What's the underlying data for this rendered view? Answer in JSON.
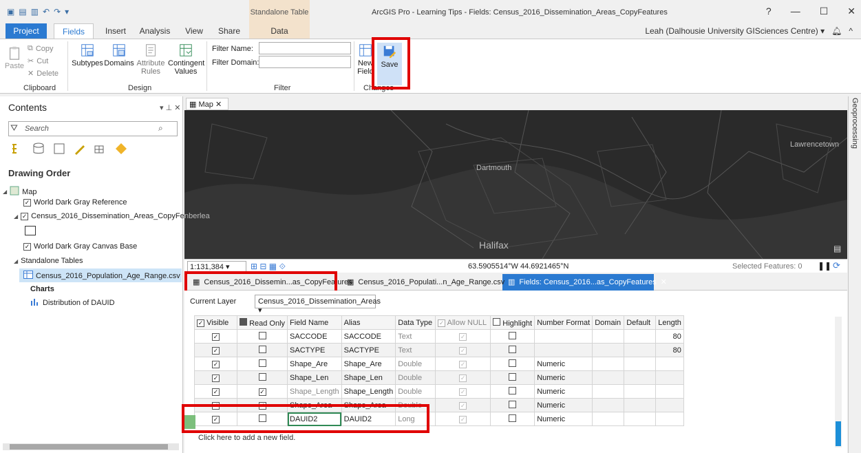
{
  "window": {
    "title": "ArcGIS Pro - Learning Tips - Fields: Census_2016_Dissemination_Areas_CopyFeatures",
    "context_title": "Standalone Table",
    "controls": [
      "?",
      "—",
      "☐",
      "✕"
    ]
  },
  "ribbon_tabs": [
    "Project",
    "Fields",
    "Insert",
    "Analysis",
    "View",
    "Share",
    "Data"
  ],
  "user": "Leah (Dalhousie University GISciences Centre) ▾",
  "ribbon": {
    "clipboard": {
      "paste": "Paste",
      "copy": "Copy",
      "cut": "Cut",
      "delete": "Delete",
      "label": "Clipboard"
    },
    "design": {
      "subtypes": "Subtypes",
      "domains": "Domains",
      "attribute_rules": "Attribute Rules",
      "contingent_values": "Contingent Values",
      "label": "Design"
    },
    "filter": {
      "filter_name": "Filter Name:",
      "filter_domain": "Filter Domain:",
      "label": "Filter"
    },
    "changes": {
      "new_field": "New Field",
      "save": "Save",
      "label": "Changes"
    }
  },
  "contents": {
    "title": "Contents",
    "search_placeholder": "Search",
    "drawing_order": "Drawing Order",
    "map": "Map",
    "layers": [
      "World Dark Gray Reference",
      "Census_2016_Dissemination_Areas_CopyFeatu",
      "World Dark Gray Canvas Base"
    ],
    "standalone_tables": "Standalone Tables",
    "csv": "Census_2016_Population_Age_Range.csv",
    "charts": "Charts",
    "chart_item": "Distribution of DAUID"
  },
  "map": {
    "tab": "Map",
    "labels": {
      "dartmouth": "Dartmouth",
      "lawrencetown": "Lawrencetown",
      "halifax": "Halifax",
      "berlea": "nberlea"
    },
    "scale": "1:131,384",
    "coords": "63.5905514°W 44.6921465°N",
    "selected": "Selected Features: 0"
  },
  "table_tabs": [
    "Census_2016_Dissemin...as_CopyFeatures",
    "Census_2016_Populati...n_Age_Range.csv",
    "Fields: Census_2016...as_CopyFeatures"
  ],
  "fields_view": {
    "current_layer_label": "Current Layer",
    "current_layer_value": "Census_2016_Dissemination_Areas",
    "headers": [
      "Visible",
      "Read Only",
      "Field Name",
      "Alias",
      "Data Type",
      "Allow NULL",
      "Highlight",
      "Number Format",
      "Domain",
      "Default",
      "Length"
    ],
    "rows": [
      {
        "visible": "✓",
        "readonly": "",
        "name": "SACCODE",
        "alias": "SACCODE",
        "type": "Text",
        "format": "",
        "length": "80"
      },
      {
        "visible": "✓",
        "readonly": "",
        "name": "SACTYPE",
        "alias": "SACTYPE",
        "type": "Text",
        "format": "",
        "length": "80"
      },
      {
        "visible": "✓",
        "readonly": "",
        "name": "Shape_Are",
        "alias": "Shape_Are",
        "type": "Double",
        "format": "Numeric",
        "length": ""
      },
      {
        "visible": "✓",
        "readonly": "",
        "name": "Shape_Len",
        "alias": "Shape_Len",
        "type": "Double",
        "format": "Numeric",
        "length": ""
      },
      {
        "visible": "✓",
        "readonly": "✓",
        "name": "Shape_Length",
        "alias": "Shape_Length",
        "type": "Double",
        "format": "Numeric",
        "length": ""
      },
      {
        "visible": "✓",
        "readonly": "✓",
        "name": "Shape_Area",
        "alias": "Shape_Area",
        "type": "Double",
        "format": "Numeric",
        "length": ""
      },
      {
        "visible": "✓",
        "readonly": "",
        "name": "DAUID2",
        "alias": "DAUID2",
        "type": "Long",
        "format": "Numeric",
        "length": ""
      }
    ],
    "add_field": "Click here to add a new field."
  },
  "geoprocessing": "Geoprocessing",
  "colors": {
    "accent": "#2b7ad1",
    "highlight": "#e00000"
  }
}
